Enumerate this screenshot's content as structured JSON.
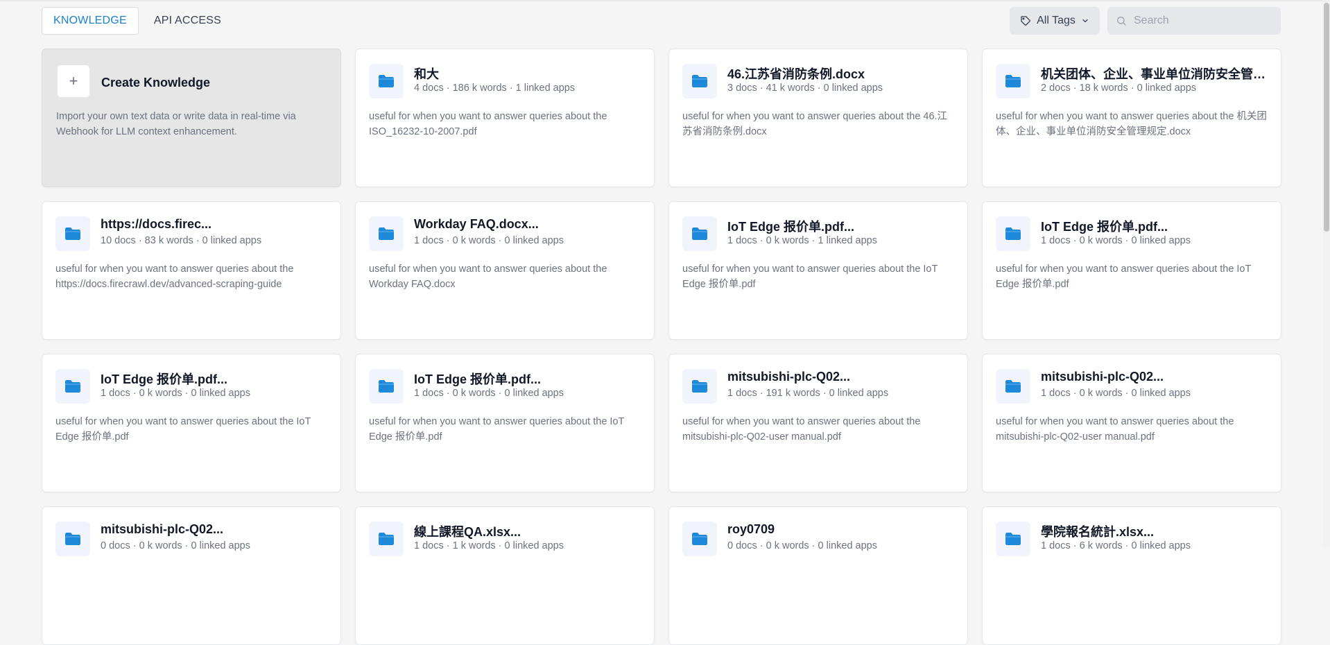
{
  "tabs": [
    {
      "label": "KNOWLEDGE",
      "active": true
    },
    {
      "label": "API ACCESS",
      "active": false
    }
  ],
  "toolbar": {
    "tags_label": "All Tags",
    "search_placeholder": "Search"
  },
  "create_card": {
    "plus": "+",
    "title": "Create Knowledge",
    "description": "Import your own text data or write data in real-time via Webhook for LLM context enhancement."
  },
  "knowledge_cards": [
    {
      "title": "和大",
      "meta": "4 docs · 186 k words · 1 linked apps",
      "description": "useful for when you want to answer queries about the ISO_16232-10-2007.pdf"
    },
    {
      "title": "46.江苏省消防条例.docx",
      "meta": "3 docs · 41 k words · 0 linked apps",
      "description": "useful for when you want to answer queries about the 46.江苏省消防条例.docx"
    },
    {
      "title": "机关团体、企业、事业单位消防安全管理规定.docx",
      "meta": "2 docs · 18 k words · 0 linked apps",
      "description": "useful for when you want to answer queries about the 机关团体、企业、事业单位消防安全管理规定.docx"
    },
    {
      "title": "https://docs.firec...",
      "meta": "10 docs · 83 k words · 0 linked apps",
      "description": "useful for when you want to answer queries about the https://docs.firecrawl.dev/advanced-scraping-guide"
    },
    {
      "title": "Workday FAQ.docx...",
      "meta": "1 docs · 0 k words · 0 linked apps",
      "description": "useful for when you want to answer queries about the Workday FAQ.docx"
    },
    {
      "title": "IoT Edge 报价单.pdf...",
      "meta": "1 docs · 0 k words · 1 linked apps",
      "description": "useful for when you want to answer queries about the IoT Edge 报价单.pdf"
    },
    {
      "title": "IoT Edge 报价单.pdf...",
      "meta": "1 docs · 0 k words · 0 linked apps",
      "description": "useful for when you want to answer queries about the IoT Edge 报价单.pdf"
    },
    {
      "title": "IoT Edge 报价单.pdf...",
      "meta": "1 docs · 0 k words · 0 linked apps",
      "description": "useful for when you want to answer queries about the IoT Edge 报价单.pdf"
    },
    {
      "title": "IoT Edge 报价单.pdf...",
      "meta": "1 docs · 0 k words · 0 linked apps",
      "description": "useful for when you want to answer queries about the IoT Edge 报价单.pdf"
    },
    {
      "title": "mitsubishi-plc-Q02...",
      "meta": "1 docs · 191 k words · 0 linked apps",
      "description": "useful for when you want to answer queries about the mitsubishi-plc-Q02-user manual.pdf"
    },
    {
      "title": "mitsubishi-plc-Q02...",
      "meta": "1 docs · 0 k words · 0 linked apps",
      "description": "useful for when you want to answer queries about the mitsubishi-plc-Q02-user manual.pdf"
    },
    {
      "title": "mitsubishi-plc-Q02...",
      "meta": "0 docs · 0 k words · 0 linked apps",
      "description": ""
    },
    {
      "title": "線上課程QA.xlsx...",
      "meta": "1 docs · 1 k words · 0 linked apps",
      "description": ""
    },
    {
      "title": "roy0709",
      "meta": "0 docs · 0 k words · 0 linked apps",
      "description": ""
    },
    {
      "title": "學院報名統計.xlsx...",
      "meta": "1 docs · 6 k words · 0 linked apps",
      "description": ""
    }
  ],
  "colors": {
    "accent": "#1b7fd0",
    "folder": "#1e88d9",
    "background": "#f5f5f5"
  },
  "icons": {
    "tag": "tag-icon",
    "chevron": "chevron-down-icon",
    "search": "search-icon",
    "folder": "folder-icon"
  }
}
